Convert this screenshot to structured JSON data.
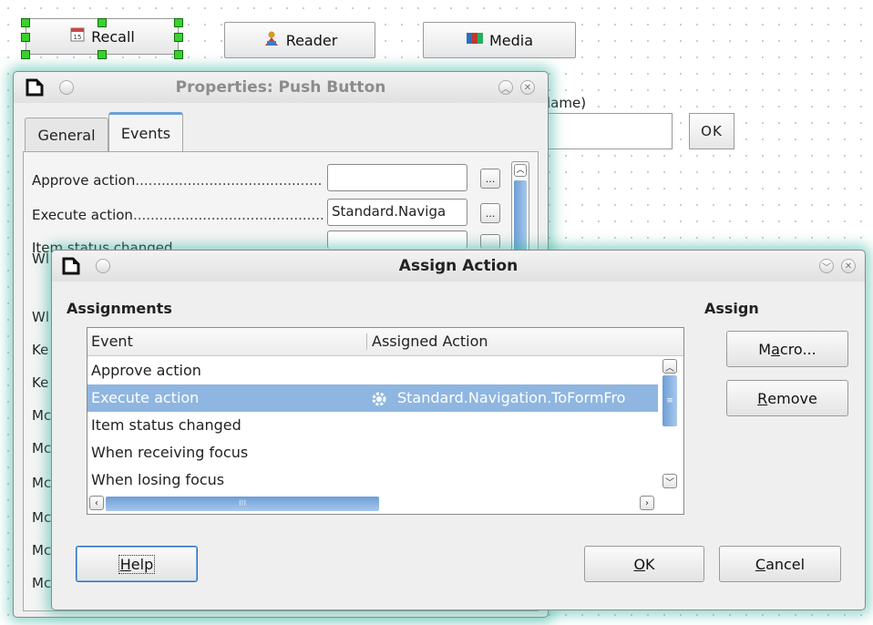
{
  "form": {
    "recall_label": "Recall",
    "reader_label": "Reader",
    "media_label": "Media",
    "partial_label": "lame)",
    "ok_label": "OK"
  },
  "properties_dialog": {
    "title": "Properties: Push Button",
    "tabs": [
      "General",
      "Events"
    ],
    "active_tab": "Events",
    "rows": [
      {
        "label": "Approve action",
        "value": ""
      },
      {
        "label": "Execute action",
        "value": "Standard.Naviga"
      },
      {
        "label": "Item status changed",
        "value": ""
      }
    ],
    "partial_rows": [
      "Wl",
      "Wl",
      "Ke",
      "Ke",
      "Mc",
      "Mc",
      "Mc",
      "Mc",
      "Mc",
      "Mc"
    ],
    "browse_label": "..."
  },
  "assign_dialog": {
    "title": "Assign Action",
    "assignments_heading": "Assignments",
    "assign_heading": "Assign",
    "columns": [
      "Event",
      "Assigned Action"
    ],
    "rows": [
      {
        "event": "Approve action",
        "action": ""
      },
      {
        "event": "Execute action",
        "action": "Standard.Navigation.ToFormFro"
      },
      {
        "event": "Item status changed",
        "action": ""
      },
      {
        "event": "When receiving focus",
        "action": ""
      },
      {
        "event": "When losing focus",
        "action": ""
      }
    ],
    "selected_index": 1,
    "hscroll_grip": "III",
    "buttons": {
      "macro": {
        "pre": "M",
        "accel": "a",
        "post": "cro..."
      },
      "remove": {
        "pre": "",
        "accel": "R",
        "post": "emove"
      },
      "help": {
        "pre": "",
        "accel": "H",
        "post": "elp"
      },
      "ok": {
        "pre": "",
        "accel": "O",
        "post": "K"
      },
      "cancel": {
        "pre": "",
        "accel": "C",
        "post": "ancel"
      }
    }
  },
  "colors": {
    "selection": "#8fb6e0",
    "handle": "#3bd12e",
    "glow": "#3cb4a0"
  }
}
